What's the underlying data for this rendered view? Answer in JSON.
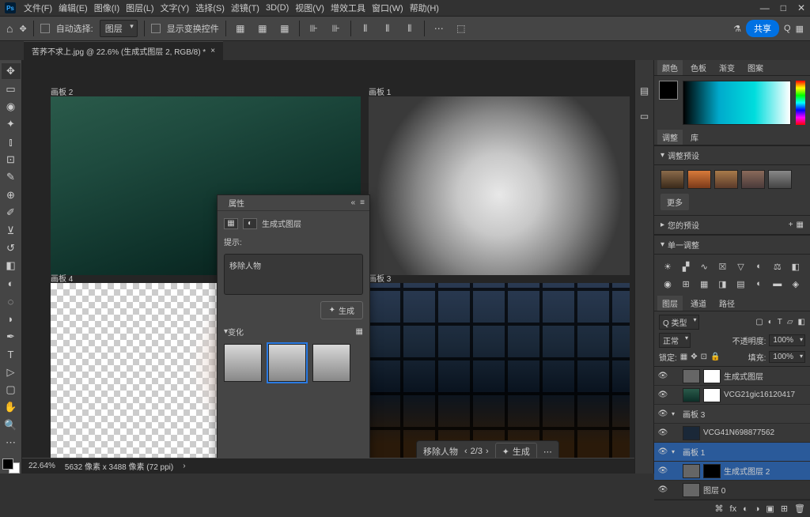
{
  "menu": [
    "文件(F)",
    "编辑(E)",
    "图像(I)",
    "图层(L)",
    "文字(Y)",
    "选择(S)",
    "滤镜(T)",
    "3D(D)",
    "视图(V)",
    "增效工具",
    "窗口(W)",
    "帮助(H)"
  ],
  "options_bar": {
    "auto_select": "自动选择:",
    "layer_dropdown": "图层",
    "show_transform": "显示变换控件",
    "share": "共享"
  },
  "document_tab": "苦荞不求上.jpg @ 22.6% (生成式图层 2, RGB/8) *",
  "artboards": {
    "ab1_label": "画板 2",
    "ab2_label": "画板 1",
    "ab3_label": "画板 4",
    "ab4_label": "画板 3"
  },
  "gen_bar": {
    "prompt": "移除人物",
    "page": "2/3",
    "generate": "生成"
  },
  "properties": {
    "title": "属性",
    "layer_type": "生成式图层",
    "prompt_label": "提示:",
    "prompt_value": "移除人物",
    "generate_btn": "生成",
    "variations": "变化"
  },
  "right_panels": {
    "color_tabs": [
      "颜色",
      "色板",
      "渐变",
      "图案"
    ],
    "lib_tabs": [
      "库",
      "库"
    ],
    "adjustments": {
      "title": "调整",
      "preset_title": "调整预设",
      "more": "更多",
      "your_presets": "您的预设",
      "single_adjust": "单一调整"
    },
    "layers": {
      "tabs": [
        "图层",
        "通道",
        "路径"
      ],
      "kind": "Q 类型",
      "blend_mode": "正常",
      "opacity_label": "不透明度:",
      "opacity_value": "100%",
      "lock_label": "锁定:",
      "fill_label": "填充:",
      "fill_value": "100%",
      "items": [
        {
          "name": "生成式图层",
          "type": "gen"
        },
        {
          "name": "VCG21gic16120417",
          "type": "img"
        },
        {
          "name": "画板 3",
          "type": "group"
        },
        {
          "name": "VCG41N698877562",
          "type": "img"
        },
        {
          "name": "画板 1",
          "type": "group",
          "selected": true
        },
        {
          "name": "生成式图层 2",
          "type": "gen",
          "selected": true
        },
        {
          "name": "图层 0",
          "type": "img"
        }
      ]
    }
  },
  "status": {
    "zoom": "22.64%",
    "info": "5632 像素 x 3488 像素 (72 ppi)"
  }
}
